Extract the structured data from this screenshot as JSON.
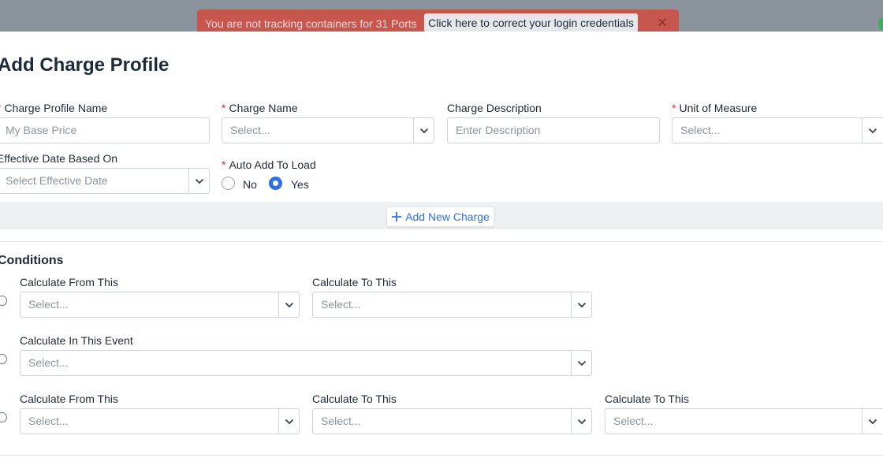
{
  "notification": {
    "message": "You are not tracking containers for 31 Ports",
    "action": "Click here to correct your login credentials",
    "close": "✕"
  },
  "modal": {
    "title": "Add Charge Profile",
    "required_mark": "*",
    "fields": {
      "profile_name": {
        "label": "Charge Profile Name",
        "placeholder": "My Base Price"
      },
      "charge_name": {
        "label": "Charge Name",
        "placeholder": "Select..."
      },
      "description": {
        "label": "Charge Description",
        "placeholder": "Enter Description"
      },
      "unit": {
        "label": "Unit of Measure",
        "placeholder": "Select..."
      },
      "effective_date": {
        "label": "Effective Date Based On",
        "placeholder": "Select Effective Date"
      },
      "auto_add": {
        "label": "Auto Add To Load",
        "options": [
          "No",
          "Yes"
        ],
        "selected": "Yes"
      }
    },
    "add_new_charge": "Add New Charge",
    "conditions": {
      "title": "Conditions",
      "rows": [
        {
          "fields": [
            {
              "label": "Calculate From This",
              "placeholder": "Select..."
            },
            {
              "label": "Calculate To This",
              "placeholder": "Select..."
            }
          ]
        },
        {
          "fields": [
            {
              "label": "Calculate In This Event",
              "placeholder": "Select..."
            }
          ]
        },
        {
          "fields": [
            {
              "label": "Calculate From This",
              "placeholder": "Select..."
            },
            {
              "label": "Calculate To This",
              "placeholder": "Select..."
            },
            {
              "label": "Calculate To This",
              "placeholder": "Select..."
            }
          ]
        }
      ]
    }
  },
  "colors": {
    "accent": "#2f6fde",
    "alert": "#c7564f",
    "required": "#dc3545",
    "status": "#3fae5b"
  }
}
